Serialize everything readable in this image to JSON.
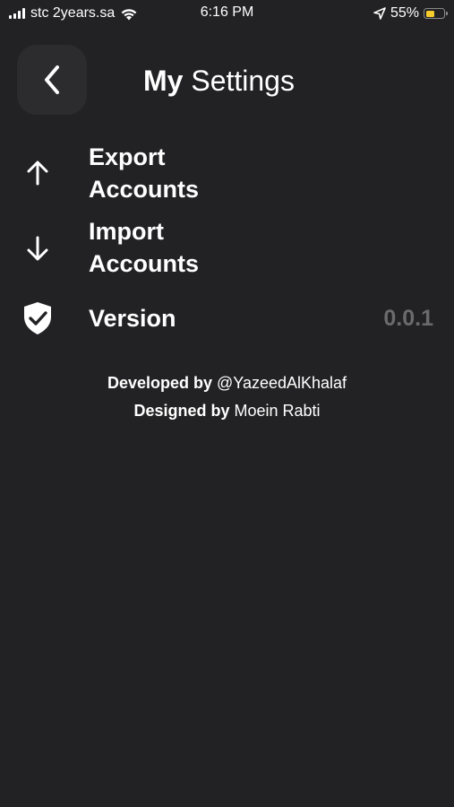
{
  "status_bar": {
    "carrier": "stc 2years.sa",
    "time": "6:16 PM",
    "battery_percent": "55%",
    "battery_level": 0.55,
    "battery_color": "#f5cc2c"
  },
  "header": {
    "title_bold": "My",
    "title_regular": "Settings",
    "back_icon": "chevron-left-icon"
  },
  "menu": {
    "export": {
      "icon": "arrow-up-icon",
      "line1": "Export",
      "line2": "Accounts"
    },
    "import": {
      "icon": "arrow-down-icon",
      "line1": "Import",
      "line2": "Accounts"
    },
    "version": {
      "icon": "shield-check-icon",
      "label": "Version",
      "value": "0.0.1"
    }
  },
  "credits": {
    "developed_label": "Developed by",
    "developer": "@YazeedAlKhalaf",
    "designed_label": "Designed by",
    "designer": "Moein Rabti"
  },
  "colors": {
    "background": "#222224",
    "back_button_bg": "#2c2c2e",
    "muted_text": "#6b6b6e"
  }
}
